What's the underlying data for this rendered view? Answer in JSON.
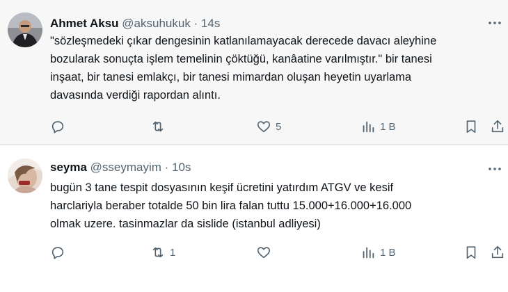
{
  "tweets": [
    {
      "name": "Ahmet Aksu",
      "handle_time": "@aksuhukuk · 14s",
      "text": "\"sözleşmedeki çıkar dengesinin katlanılamayacak derecede davacı aleyhine\nbozularak sonuçta işlem temelinin çöktüğü, kanâatine varılmıştır.\"  bir tanesi\ninşaat, bir tanesi emlakçı, bir tanesi mimardan oluşan heyetin uyarlama\ndavasında verdiği rapordan alıntı.",
      "reply_count": "",
      "retweet_count": "",
      "like_count": "5",
      "views": "1 B"
    },
    {
      "name": "seyma",
      "handle_time": "@sseymayim · 10s",
      "text": "bugün 3 tane tespit dosyasının keşif ücretini yatırdım ATGV ve kesif\nharclariyla beraber totalde 50 bin lira falan tuttu 15.000+16.000+16.000\nolmak uzere. tasinmazlar da sislide (istanbul adliyesi)",
      "reply_count": "",
      "retweet_count": "1",
      "like_count": "",
      "views": "1 B"
    }
  ],
  "icons": {
    "reply": "reply-icon",
    "retweet": "retweet-icon",
    "like": "heart-icon",
    "views": "views-icon",
    "bookmark": "bookmark-icon",
    "share": "share-icon",
    "more": "more-icon"
  },
  "colors": {
    "text": "#0f1419",
    "secondary": "#536471",
    "tweet1_bg": "#f7f7f7",
    "tweet2_bg": "#ffffff"
  }
}
